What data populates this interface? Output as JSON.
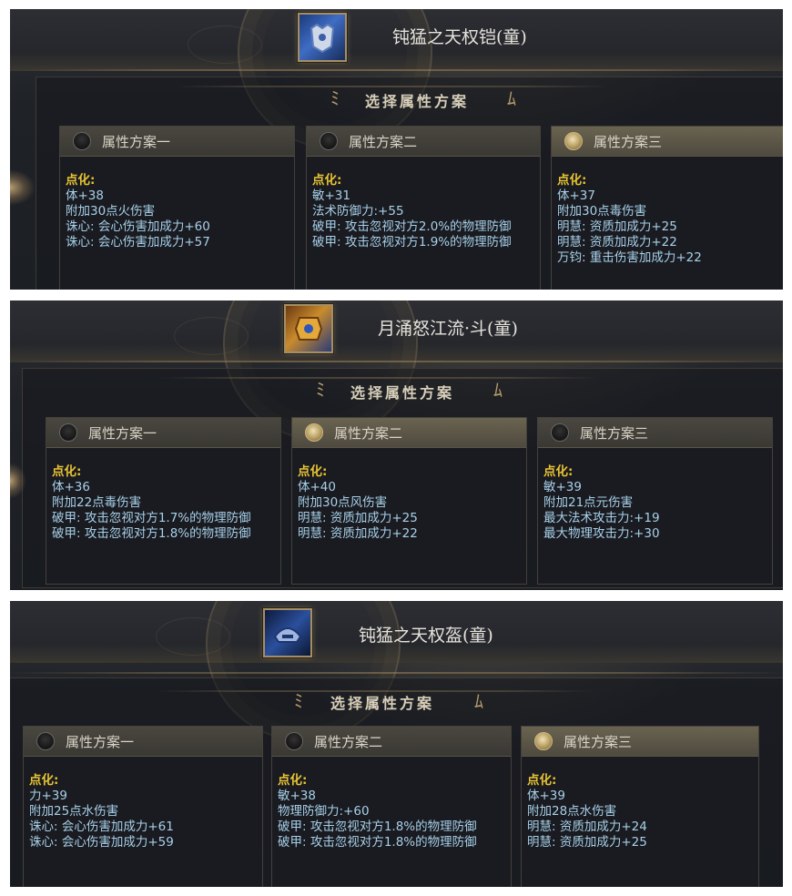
{
  "section_title": "选择属性方案",
  "icon_names": [
    "armor-icon",
    "bracer-icon",
    "helmet-icon"
  ],
  "panels": [
    {
      "item_name": "钝猛之天权铠(童)",
      "schemes": [
        {
          "label": "属性方案一",
          "selected": false,
          "lines": [
            "点化:",
            "体+38",
            "附加30点火伤害",
            "诛心: 会心伤害加成力+60",
            "诛心: 会心伤害加成力+57"
          ]
        },
        {
          "label": "属性方案二",
          "selected": false,
          "lines": [
            "点化:",
            "敏+31",
            "法术防御力:+55",
            "破甲: 攻击忽视对方2.0%的物理防御",
            "破甲: 攻击忽视对方1.9%的物理防御"
          ]
        },
        {
          "label": "属性方案三",
          "selected": true,
          "lines": [
            "点化:",
            "体+37",
            "附加30点毒伤害",
            "明慧: 资质加成力+25",
            "明慧: 资质加成力+22",
            "万钧: 重击伤害加成力+22"
          ]
        }
      ]
    },
    {
      "item_name": "月涌怒江流·斗(童)",
      "schemes": [
        {
          "label": "属性方案一",
          "selected": false,
          "lines": [
            "点化:",
            "体+36",
            "附加22点毒伤害",
            "破甲: 攻击忽视对方1.7%的物理防御",
            "破甲: 攻击忽视对方1.8%的物理防御"
          ]
        },
        {
          "label": "属性方案二",
          "selected": true,
          "lines": [
            "点化:",
            "体+40",
            "附加30点风伤害",
            "明慧: 资质加成力+25",
            "明慧: 资质加成力+22"
          ]
        },
        {
          "label": "属性方案三",
          "selected": false,
          "lines": [
            "点化:",
            "敏+39",
            "附加21点元伤害",
            "最大法术攻击力:+19",
            "最大物理攻击力:+30"
          ]
        }
      ]
    },
    {
      "item_name": "钝猛之天权盔(童)",
      "schemes": [
        {
          "label": "属性方案一",
          "selected": false,
          "lines": [
            "点化:",
            "力+39",
            "附加25点水伤害",
            "诛心: 会心伤害加成力+61",
            "诛心: 会心伤害加成力+59"
          ]
        },
        {
          "label": "属性方案二",
          "selected": false,
          "lines": [
            "点化:",
            "敏+38",
            "物理防御力:+60",
            "破甲: 攻击忽视对方1.8%的物理防御",
            "破甲: 攻击忽视对方1.8%的物理防御"
          ]
        },
        {
          "label": "属性方案三",
          "selected": true,
          "lines": [
            "点化:",
            "体+39",
            "附加28点水伤害",
            "明慧: 资质加成力+24",
            "明慧: 资质加成力+25"
          ]
        }
      ]
    }
  ]
}
